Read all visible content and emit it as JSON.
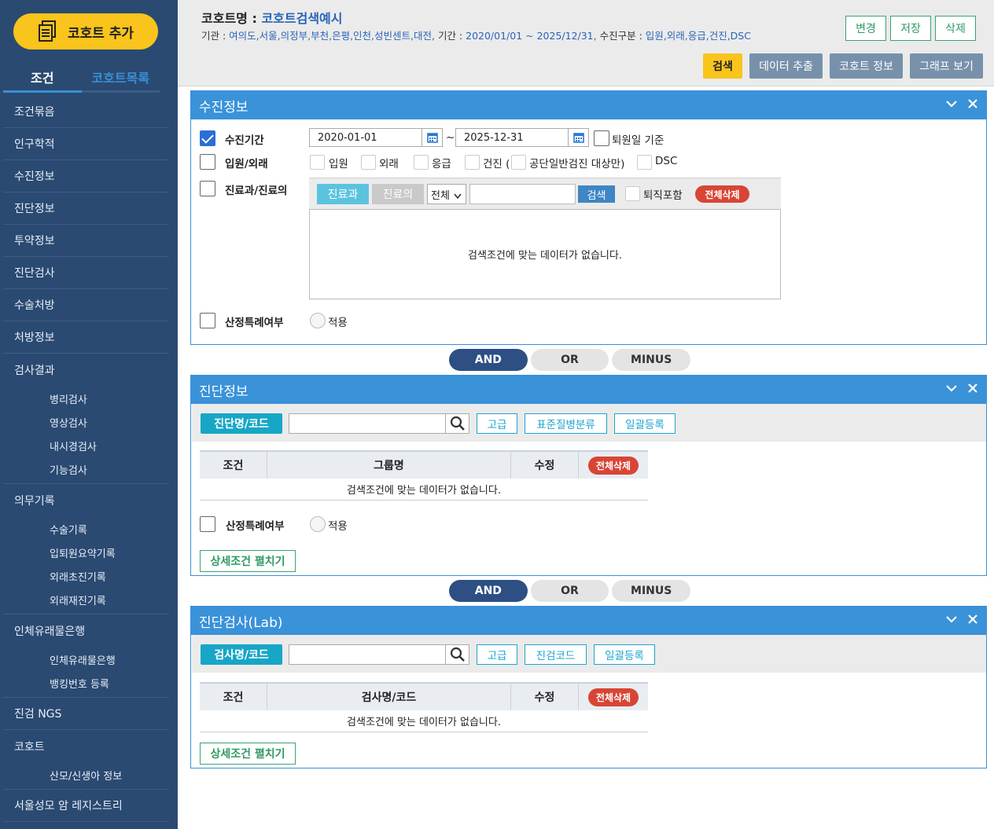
{
  "sidebar": {
    "add_label": "코호트 추가",
    "tab_conditions": "조건",
    "tab_cohort_list": "코호트목록",
    "items": [
      {
        "label": "조건묶음"
      },
      {
        "label": "인구학적"
      },
      {
        "label": "수진정보"
      },
      {
        "label": "진단정보"
      },
      {
        "label": "투약정보"
      },
      {
        "label": "진단검사"
      },
      {
        "label": "수술처방"
      },
      {
        "label": "처방정보"
      },
      {
        "label": "검사결과",
        "subs": [
          "병리검사",
          "영상검사",
          "내시경검사",
          "기능검사"
        ]
      },
      {
        "label": "의무기록",
        "subs": [
          "수술기록",
          "입퇴원요약기록",
          "외래초진기록",
          "외래재진기록"
        ]
      },
      {
        "label": "인체유래물은행",
        "subs": [
          "인체유래물은행",
          "뱅킹번호 등록"
        ]
      },
      {
        "label": "진검 NGS"
      },
      {
        "label": "코호트",
        "subs": [
          "산모/신생아 정보"
        ]
      },
      {
        "label": "서울성모 암 레지스트리"
      }
    ]
  },
  "header": {
    "title_prefix": "코호트명 :",
    "cohort_name": "코호트검색예시",
    "info_org_label": "기관 :",
    "info_org": "여의도,서울,의정부,부천,은평,인천,성빈센트,대전,",
    "info_period_label": "기간 :",
    "info_period": "2020/01/01 ~ 2025/12/31,",
    "info_type_label": "수진구분 :",
    "info_type": "입원,외래,응급,건진,DSC",
    "btn_change": "변경",
    "btn_save": "저장",
    "btn_delete": "삭제",
    "btn_search": "검색",
    "btn_extract": "데이터 추출",
    "btn_cohort_info": "코호트 정보",
    "btn_graph": "그래프 보기"
  },
  "visit_panel": {
    "title": "수진정보",
    "period_label": "수진기간",
    "period_checked": true,
    "date_from": "2020-01-01",
    "date_sep": "~",
    "date_to": "2025-12-31",
    "discharge_label": "퇴원일 기준",
    "inout_label": "입원/외래",
    "inout_opts": [
      "입원",
      "외래",
      "응급",
      "건진 (",
      "공단일반검진 대상만)",
      "DSC"
    ],
    "dept_label": "진료과/진료의",
    "dept_tab": "진료과",
    "doctor_tab": "진료의",
    "select_value": "전체",
    "search_btn": "검색",
    "retired_label": "퇴직포함",
    "delete_all": "전체삭제",
    "empty_msg": "검색조건에 맞는 데이터가 없습니다.",
    "special_label": "산정특례여부",
    "apply_label": "적용"
  },
  "logic": {
    "and": "AND",
    "or": "OR",
    "minus": "MINUS"
  },
  "diag_panel": {
    "title": "진단정보",
    "code_btn": "진단명/코드",
    "btn_advanced": "고급",
    "btn_classification": "표준질병분류",
    "btn_bulk": "일괄등록",
    "col_cond": "조건",
    "col_group": "그룹명",
    "col_edit": "수정",
    "delete_all": "전체삭제",
    "empty_msg": "검색조건에 맞는 데이터가 없습니다.",
    "special_label": "산정특례여부",
    "apply_label": "적용",
    "expand_btn": "상세조건 펼치기"
  },
  "lab_panel": {
    "title": "진단검사(Lab)",
    "code_btn": "검사명/코드",
    "btn_advanced": "고급",
    "btn_labcode": "진검코드",
    "btn_bulk": "일괄등록",
    "col_cond": "조건",
    "col_name": "검사명/코드",
    "col_edit": "수정",
    "delete_all": "전체삭제",
    "empty_msg": "검색조건에 맞는 데이터가 없습니다.",
    "expand_btn": "상세조건 펼치기"
  },
  "colors": {
    "sidebar": "#2a4a72",
    "accent": "#3a92d9",
    "yellow": "#f9c41c",
    "red": "#d84535"
  }
}
